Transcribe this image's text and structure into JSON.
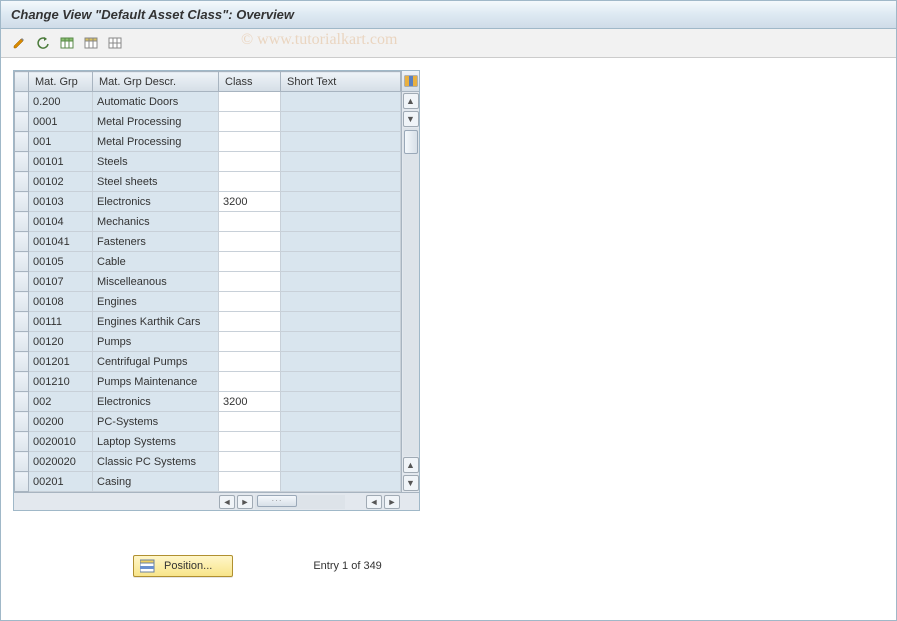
{
  "title": "Change View \"Default Asset Class\": Overview",
  "watermark": "© www.tutorialkart.com",
  "toolbar": {
    "icons": [
      "change-icon",
      "undo-icon",
      "table-green-icon",
      "table-open-icon",
      "table-blank-icon"
    ]
  },
  "columns": {
    "mat_grp": "Mat. Grp",
    "mat_grp_descr": "Mat. Grp Descr.",
    "class": "Class",
    "short_text": "Short Text"
  },
  "rows": [
    {
      "grp": "0.200",
      "descr": "Automatic Doors",
      "class": "",
      "short": ""
    },
    {
      "grp": "0001",
      "descr": "Metal Processing",
      "class": "",
      "short": ""
    },
    {
      "grp": "001",
      "descr": "Metal Processing",
      "class": "",
      "short": ""
    },
    {
      "grp": "00101",
      "descr": "Steels",
      "class": "",
      "short": ""
    },
    {
      "grp": "00102",
      "descr": "Steel sheets",
      "class": "",
      "short": ""
    },
    {
      "grp": "00103",
      "descr": "Electronics",
      "class": "3200",
      "short": ""
    },
    {
      "grp": "00104",
      "descr": "Mechanics",
      "class": "",
      "short": ""
    },
    {
      "grp": "001041",
      "descr": "Fasteners",
      "class": "",
      "short": ""
    },
    {
      "grp": "00105",
      "descr": "Cable",
      "class": "",
      "short": ""
    },
    {
      "grp": "00107",
      "descr": "Miscelleanous",
      "class": "",
      "short": ""
    },
    {
      "grp": "00108",
      "descr": "Engines",
      "class": "",
      "short": ""
    },
    {
      "grp": "00111",
      "descr": "Engines Karthik Cars",
      "class": "",
      "short": ""
    },
    {
      "grp": "00120",
      "descr": "Pumps",
      "class": "",
      "short": ""
    },
    {
      "grp": "001201",
      "descr": "Centrifugal Pumps",
      "class": "",
      "short": ""
    },
    {
      "grp": "001210",
      "descr": "Pumps Maintenance",
      "class": "",
      "short": ""
    },
    {
      "grp": "002",
      "descr": "Electronics",
      "class": "3200",
      "short": ""
    },
    {
      "grp": "00200",
      "descr": "PC-Systems",
      "class": "",
      "short": ""
    },
    {
      "grp": "0020010",
      "descr": "Laptop Systems",
      "class": "",
      "short": ""
    },
    {
      "grp": "0020020",
      "descr": "Classic PC Systems",
      "class": "",
      "short": ""
    },
    {
      "grp": "00201",
      "descr": "Casing",
      "class": "",
      "short": ""
    }
  ],
  "position_button": "Position...",
  "entry_status": "Entry 1 of 349"
}
